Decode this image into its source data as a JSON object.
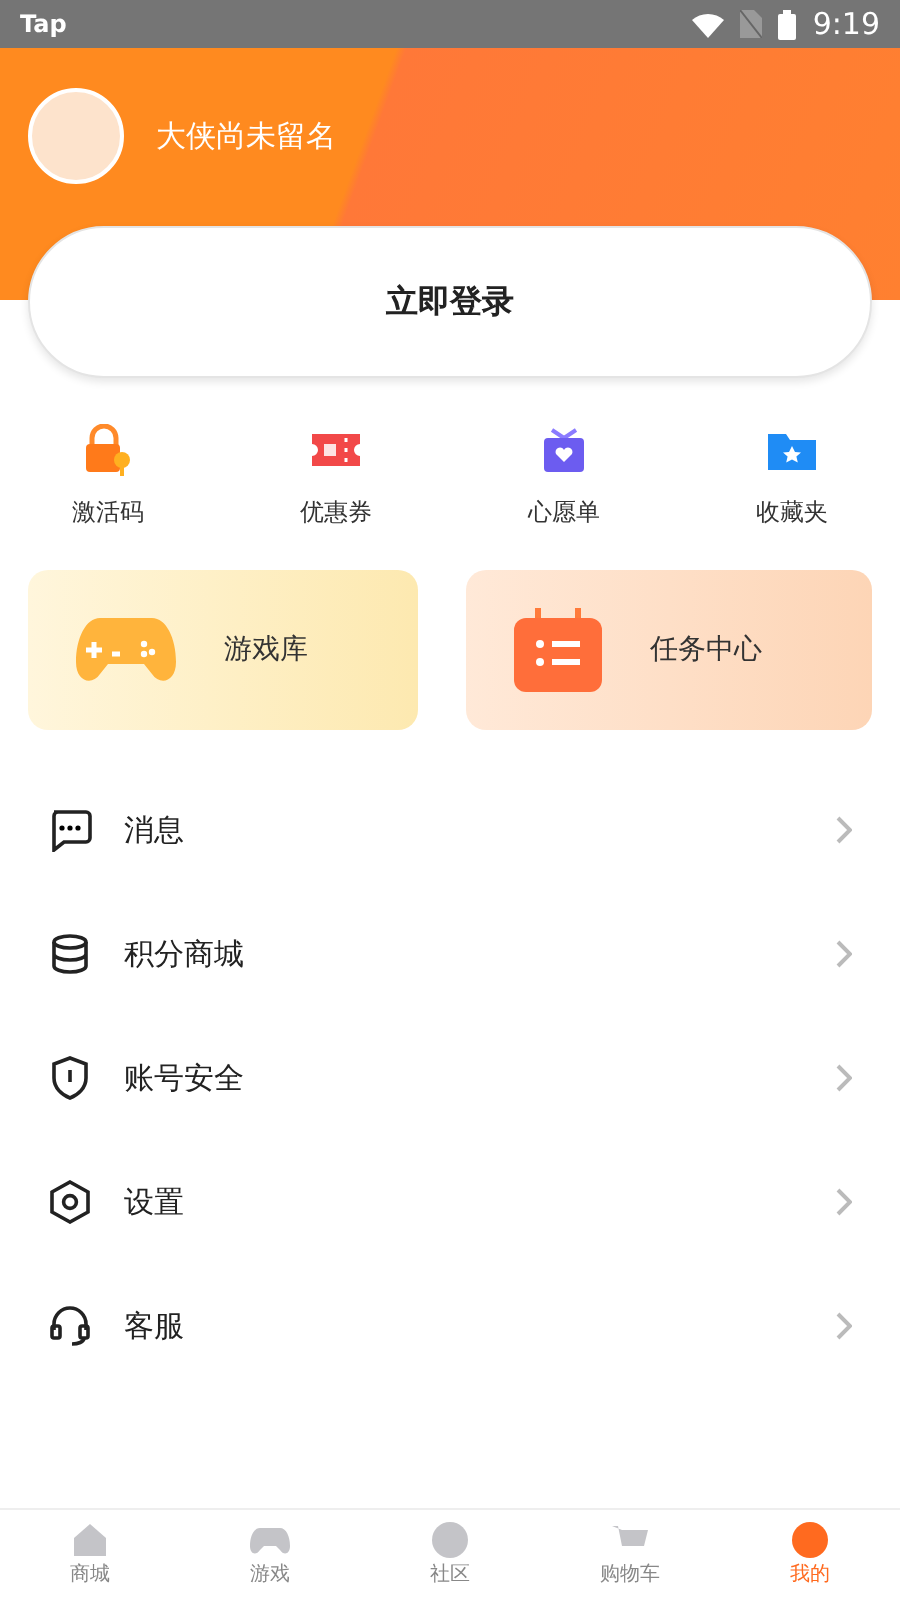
{
  "status_bar": {
    "app": "Tap",
    "time": "9:19"
  },
  "profile": {
    "name": "大侠尚未留名"
  },
  "login_button": "立即登录",
  "shortcuts": [
    {
      "label": "激活码",
      "kind": "lock"
    },
    {
      "label": "优惠券",
      "kind": "coupon"
    },
    {
      "label": "心愿单",
      "kind": "gift"
    },
    {
      "label": "收藏夹",
      "kind": "folder"
    }
  ],
  "cards": [
    {
      "label": "游戏库",
      "kind": "games"
    },
    {
      "label": "任务中心",
      "kind": "tasks"
    }
  ],
  "menu": [
    {
      "label": "消息",
      "kind": "message"
    },
    {
      "label": "积分商城",
      "kind": "points"
    },
    {
      "label": "账号安全",
      "kind": "security"
    },
    {
      "label": "设置",
      "kind": "settings"
    },
    {
      "label": "客服",
      "kind": "support"
    }
  ],
  "tab_bar": [
    {
      "label": "商城",
      "kind": "home",
      "selected": false
    },
    {
      "label": "游戏",
      "kind": "game",
      "selected": false
    },
    {
      "label": "社区",
      "kind": "chat",
      "selected": false
    },
    {
      "label": "购物车",
      "kind": "cart",
      "selected": false
    },
    {
      "label": "我的",
      "kind": "me",
      "selected": true
    }
  ]
}
